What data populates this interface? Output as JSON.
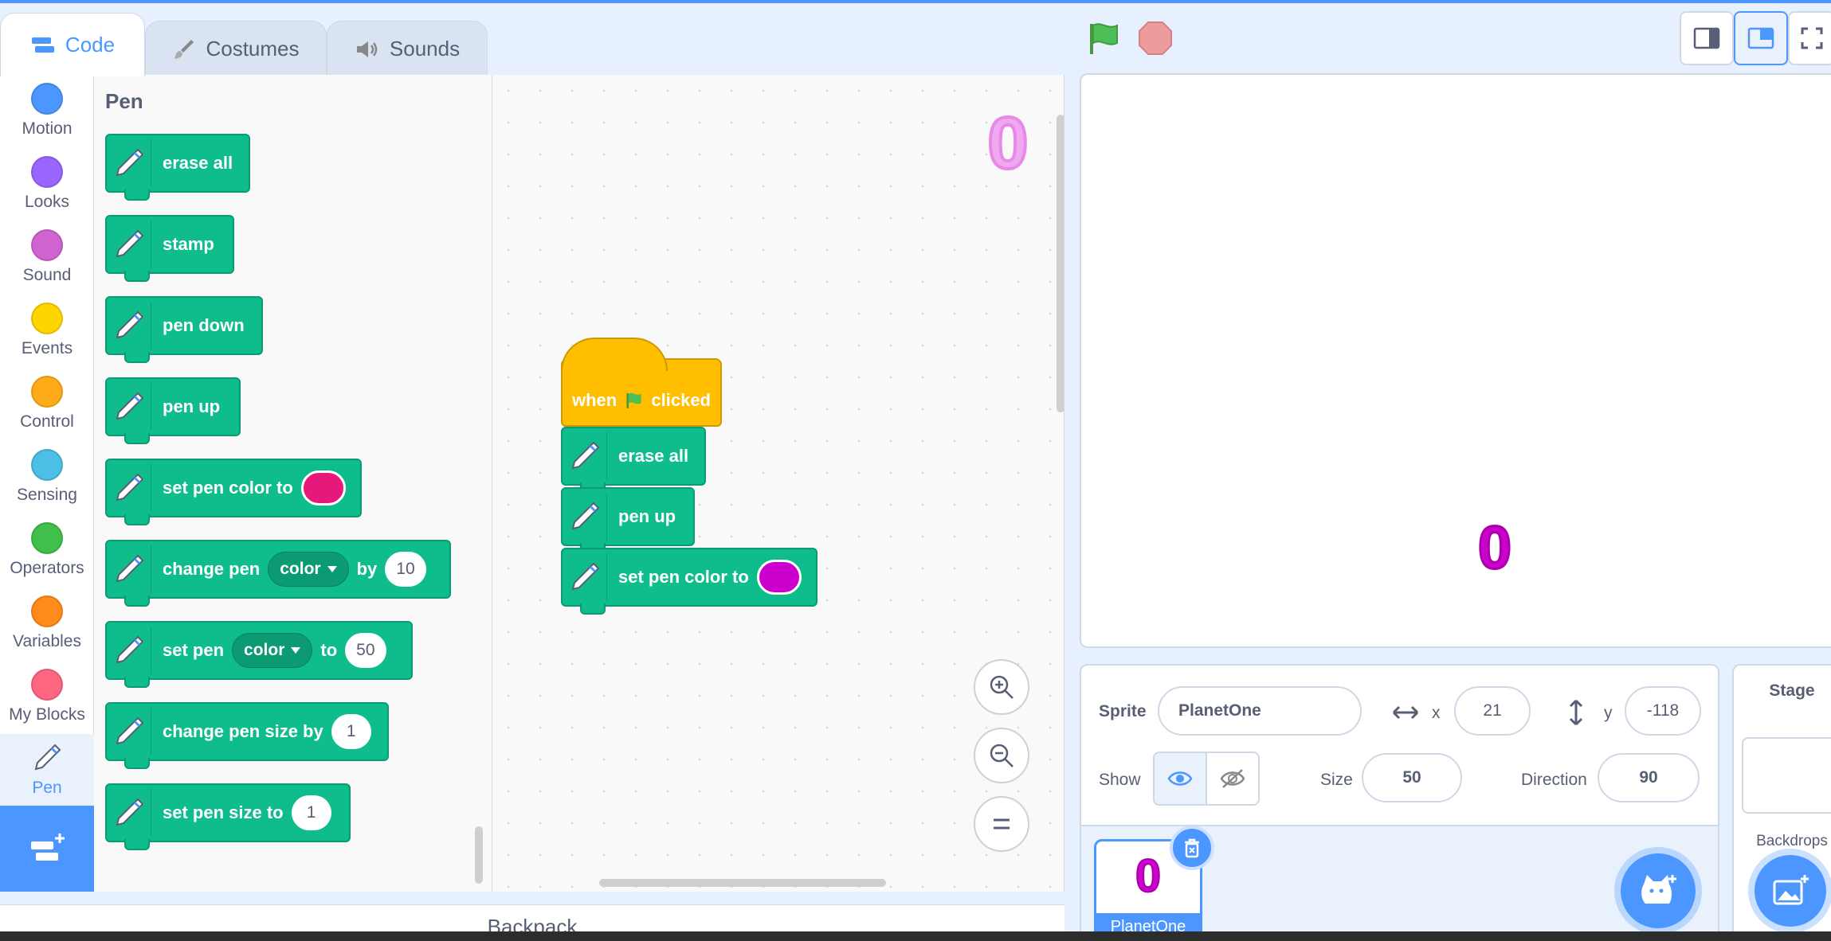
{
  "tabs": {
    "code": "Code",
    "costumes": "Costumes",
    "sounds": "Sounds"
  },
  "categories": [
    {
      "label": "Motion",
      "color": "#4c97ff"
    },
    {
      "label": "Looks",
      "color": "#9966ff"
    },
    {
      "label": "Sound",
      "color": "#cf63cf"
    },
    {
      "label": "Events",
      "color": "#ffd500"
    },
    {
      "label": "Control",
      "color": "#ffab19"
    },
    {
      "label": "Sensing",
      "color": "#4cbfe6"
    },
    {
      "label": "Operators",
      "color": "#40bf4a"
    },
    {
      "label": "Variables",
      "color": "#ff8c1a"
    },
    {
      "label": "My Blocks",
      "color": "#ff6680"
    },
    {
      "label": "Pen",
      "color": "#0fbd8c"
    }
  ],
  "palette": {
    "title": "Pen",
    "erase_all": "erase all",
    "stamp": "stamp",
    "pen_down": "pen down",
    "pen_up": "pen up",
    "set_pen_color": "set pen color to",
    "set_pen_color_value": "#e6197a",
    "change_pen": "change pen",
    "change_pen_param": "color",
    "change_pen_by": "by",
    "change_pen_value": "10",
    "set_pen": "set pen",
    "set_pen_param": "color",
    "set_pen_to": "to",
    "set_pen_value": "50",
    "change_pen_size": "change pen size by",
    "change_pen_size_value": "1",
    "set_pen_size": "set pen size to",
    "set_pen_size_value": "1"
  },
  "script": {
    "when": "when",
    "clicked": "clicked",
    "erase_all": "erase all",
    "pen_up": "pen up",
    "set_pen_color": "set pen color to",
    "set_pen_color_value": "#cc00cc"
  },
  "backpack": "Backpack",
  "sprite_info": {
    "sprite_label": "Sprite",
    "sprite_name": "PlanetOne",
    "x_label": "x",
    "x_value": "21",
    "y_label": "y",
    "y_value": "-118",
    "show_label": "Show",
    "size_label": "Size",
    "size_value": "50",
    "direction_label": "Direction",
    "direction_value": "90"
  },
  "sprite_thumb": {
    "name": "PlanetOne",
    "costume_glyph": "0"
  },
  "stage_sprite_glyph": "0",
  "ws_costume_glyph": "0",
  "stage_panel": {
    "title": "Stage",
    "backdrops": "Backdrops"
  }
}
